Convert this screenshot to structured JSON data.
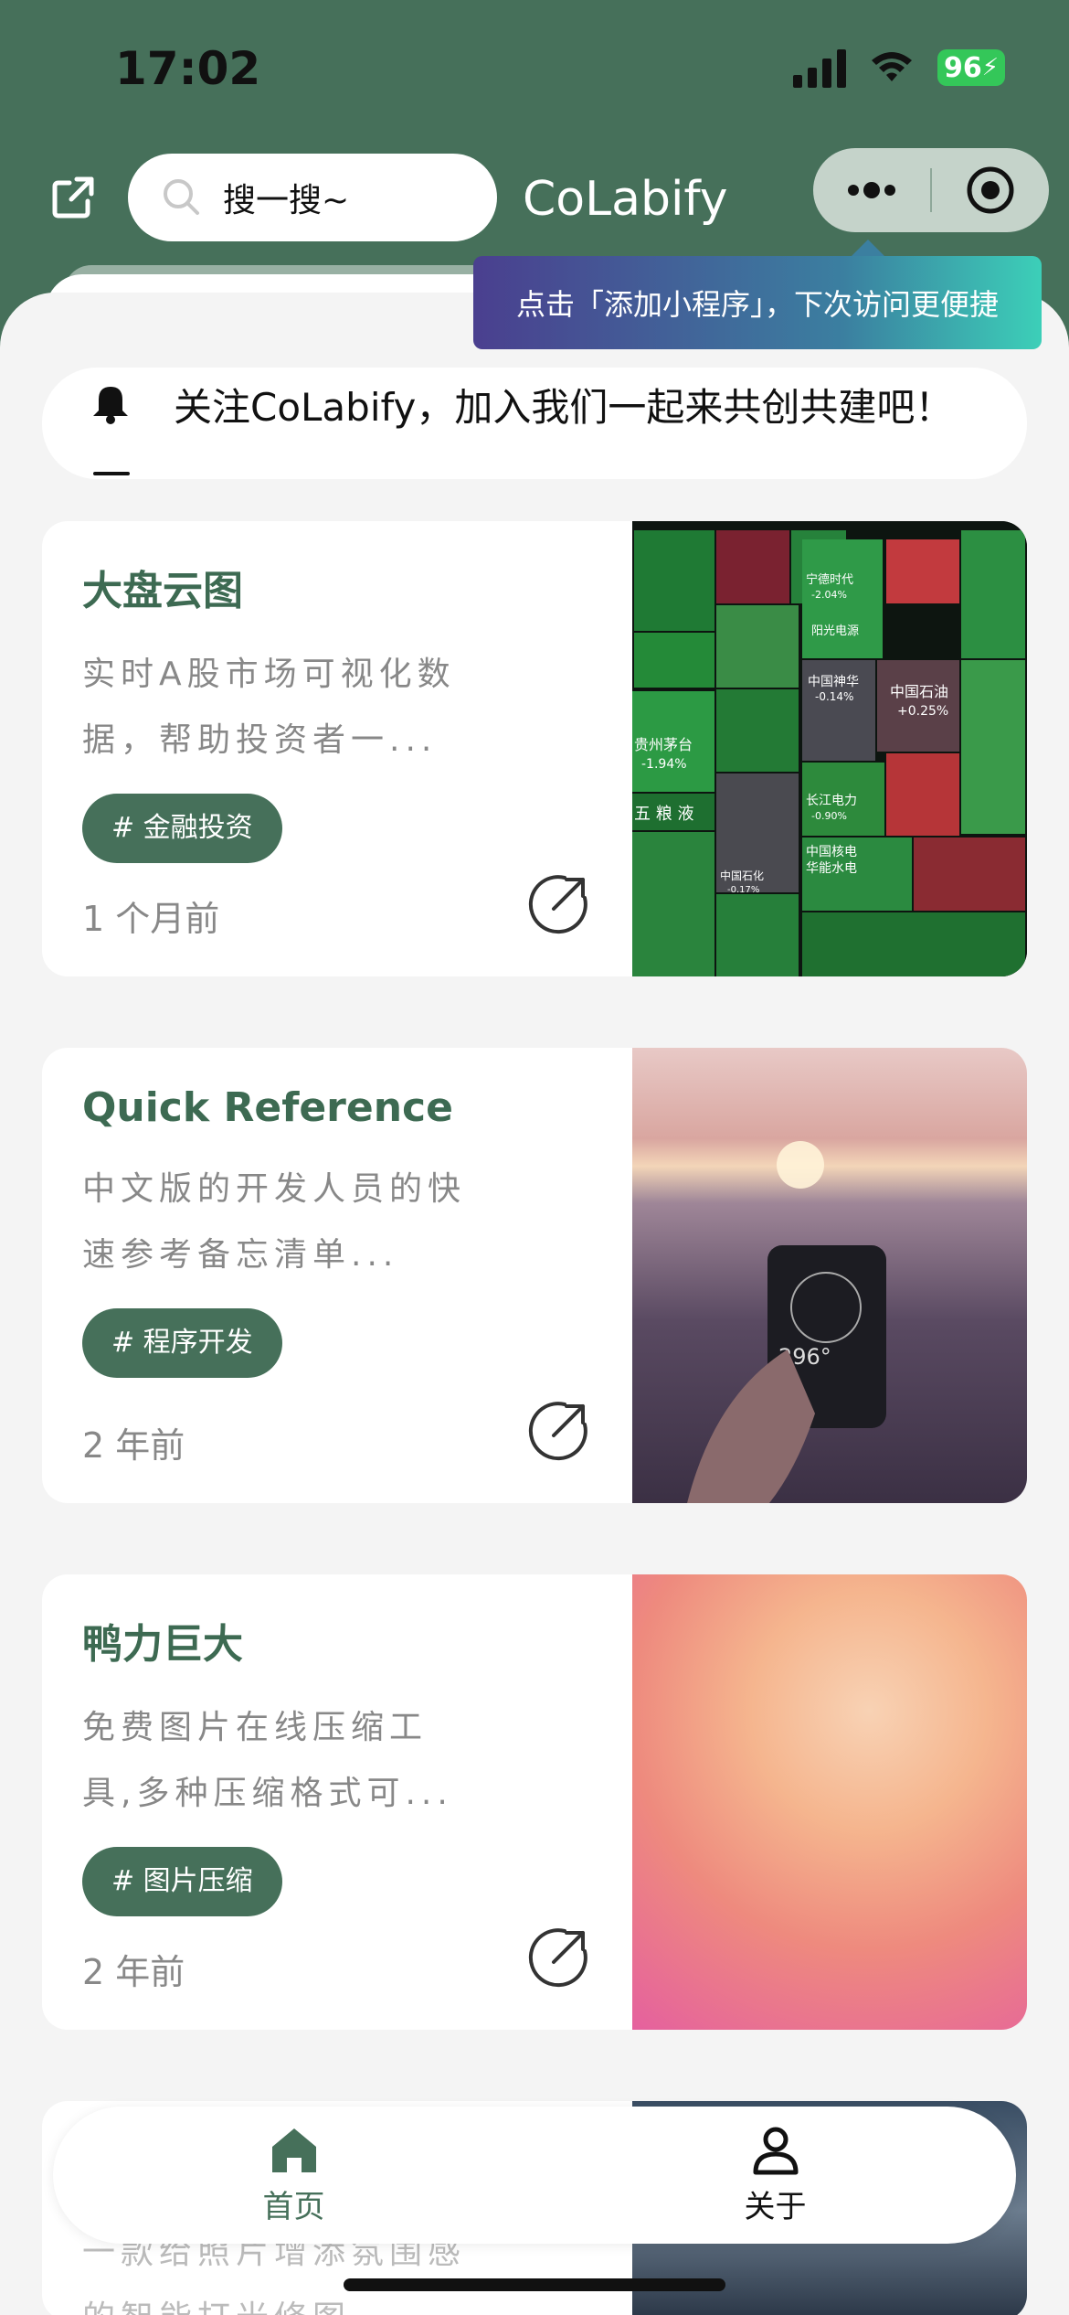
{
  "status_bar": {
    "time": "17:02",
    "battery": "96"
  },
  "header": {
    "search_placeholder": "搜一搜~",
    "app_title": "CoLabify"
  },
  "tooltip": {
    "text": "点击「添加小程序」，下次访问更便捷"
  },
  "notice": {
    "text": "关注CoLabify，加入我们一起来共创共建吧！"
  },
  "cards": [
    {
      "title": "大盘云图",
      "desc": "实时A股市场可视化数据，帮助投资者一...",
      "tag": "# 金融投资",
      "time": "1 个月前",
      "image_labels": [
        "宁德时代",
        "-2.04%",
        "阳光电源",
        "中国神华",
        "-0.14%",
        "中国石油",
        "+0.25%",
        "贵州茅台",
        "-1.94%",
        "五 粮 液",
        "长江电力",
        "-0.90%",
        "中国核电",
        "华能水电",
        "中国石化",
        "-0.17%"
      ]
    },
    {
      "title": "Quick Reference",
      "desc": "中文版的开发人员的快速参考备忘清单...",
      "tag": "# 程序开发",
      "time": "2 年前",
      "image_labels": [
        "296°"
      ]
    },
    {
      "title": "鸭力巨大",
      "desc": "免费图片在线压缩工具,多种压缩格式可...",
      "tag": "# 图片压缩",
      "time": "2 年前"
    },
    {
      "title": "",
      "desc": "一款给照片增添氛围感的智能打光修图",
      "tag": "",
      "time": ""
    }
  ],
  "tabbar": {
    "home_label": "首页",
    "about_label": "关于",
    "active_color": "#46705a"
  },
  "colors": {
    "brand": "#46705a",
    "tag_bg": "#46705a"
  }
}
